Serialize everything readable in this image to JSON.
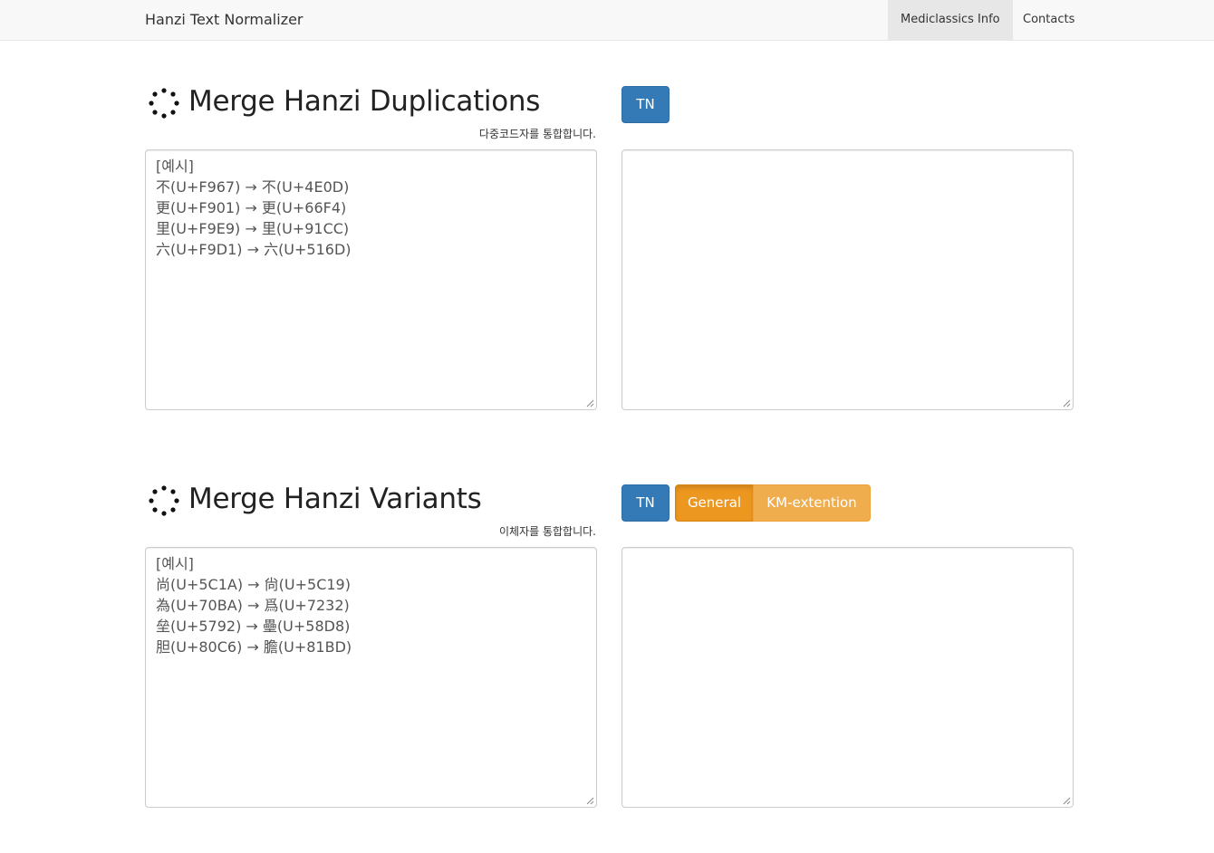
{
  "navbar": {
    "brand": "Hanzi Text Normalizer",
    "links": [
      "Mediclassics Info",
      "Contacts"
    ]
  },
  "duplications": {
    "title": "Merge Hanzi Duplications",
    "subtitle": "다중코드자를 통합합니다.",
    "tn_label": "TN",
    "input_lines": [
      "[예시]",
      "不(U+F967) → 不(U+4E0D)",
      "更(U+F901) → 更(U+66F4)",
      "里(U+F9E9) → 里(U+91CC)",
      "六(U+F9D1) → 六(U+516D)"
    ],
    "output_value": ""
  },
  "variants": {
    "title": "Merge Hanzi Variants",
    "subtitle": "이체자를 통합합니다.",
    "tn_label": "TN",
    "modes": [
      "General",
      "KM-extention"
    ],
    "active_mode": "General",
    "input_lines": [
      "[예시]",
      "尚(U+5C1A) → 尙(U+5C19)",
      "為(U+70BA) → 爲(U+7232)",
      "垒(U+5792) → 壘(U+58D8)",
      "胆(U+80C6) → 膽(U+81BD)"
    ],
    "output_value": ""
  },
  "icons": {
    "section_icon": "spinner-icon",
    "resize": "resize-grip-icon"
  },
  "colors": {
    "primary": "#337ab7",
    "warning": "#f0ad4e",
    "warning_active": "#ec971f"
  }
}
